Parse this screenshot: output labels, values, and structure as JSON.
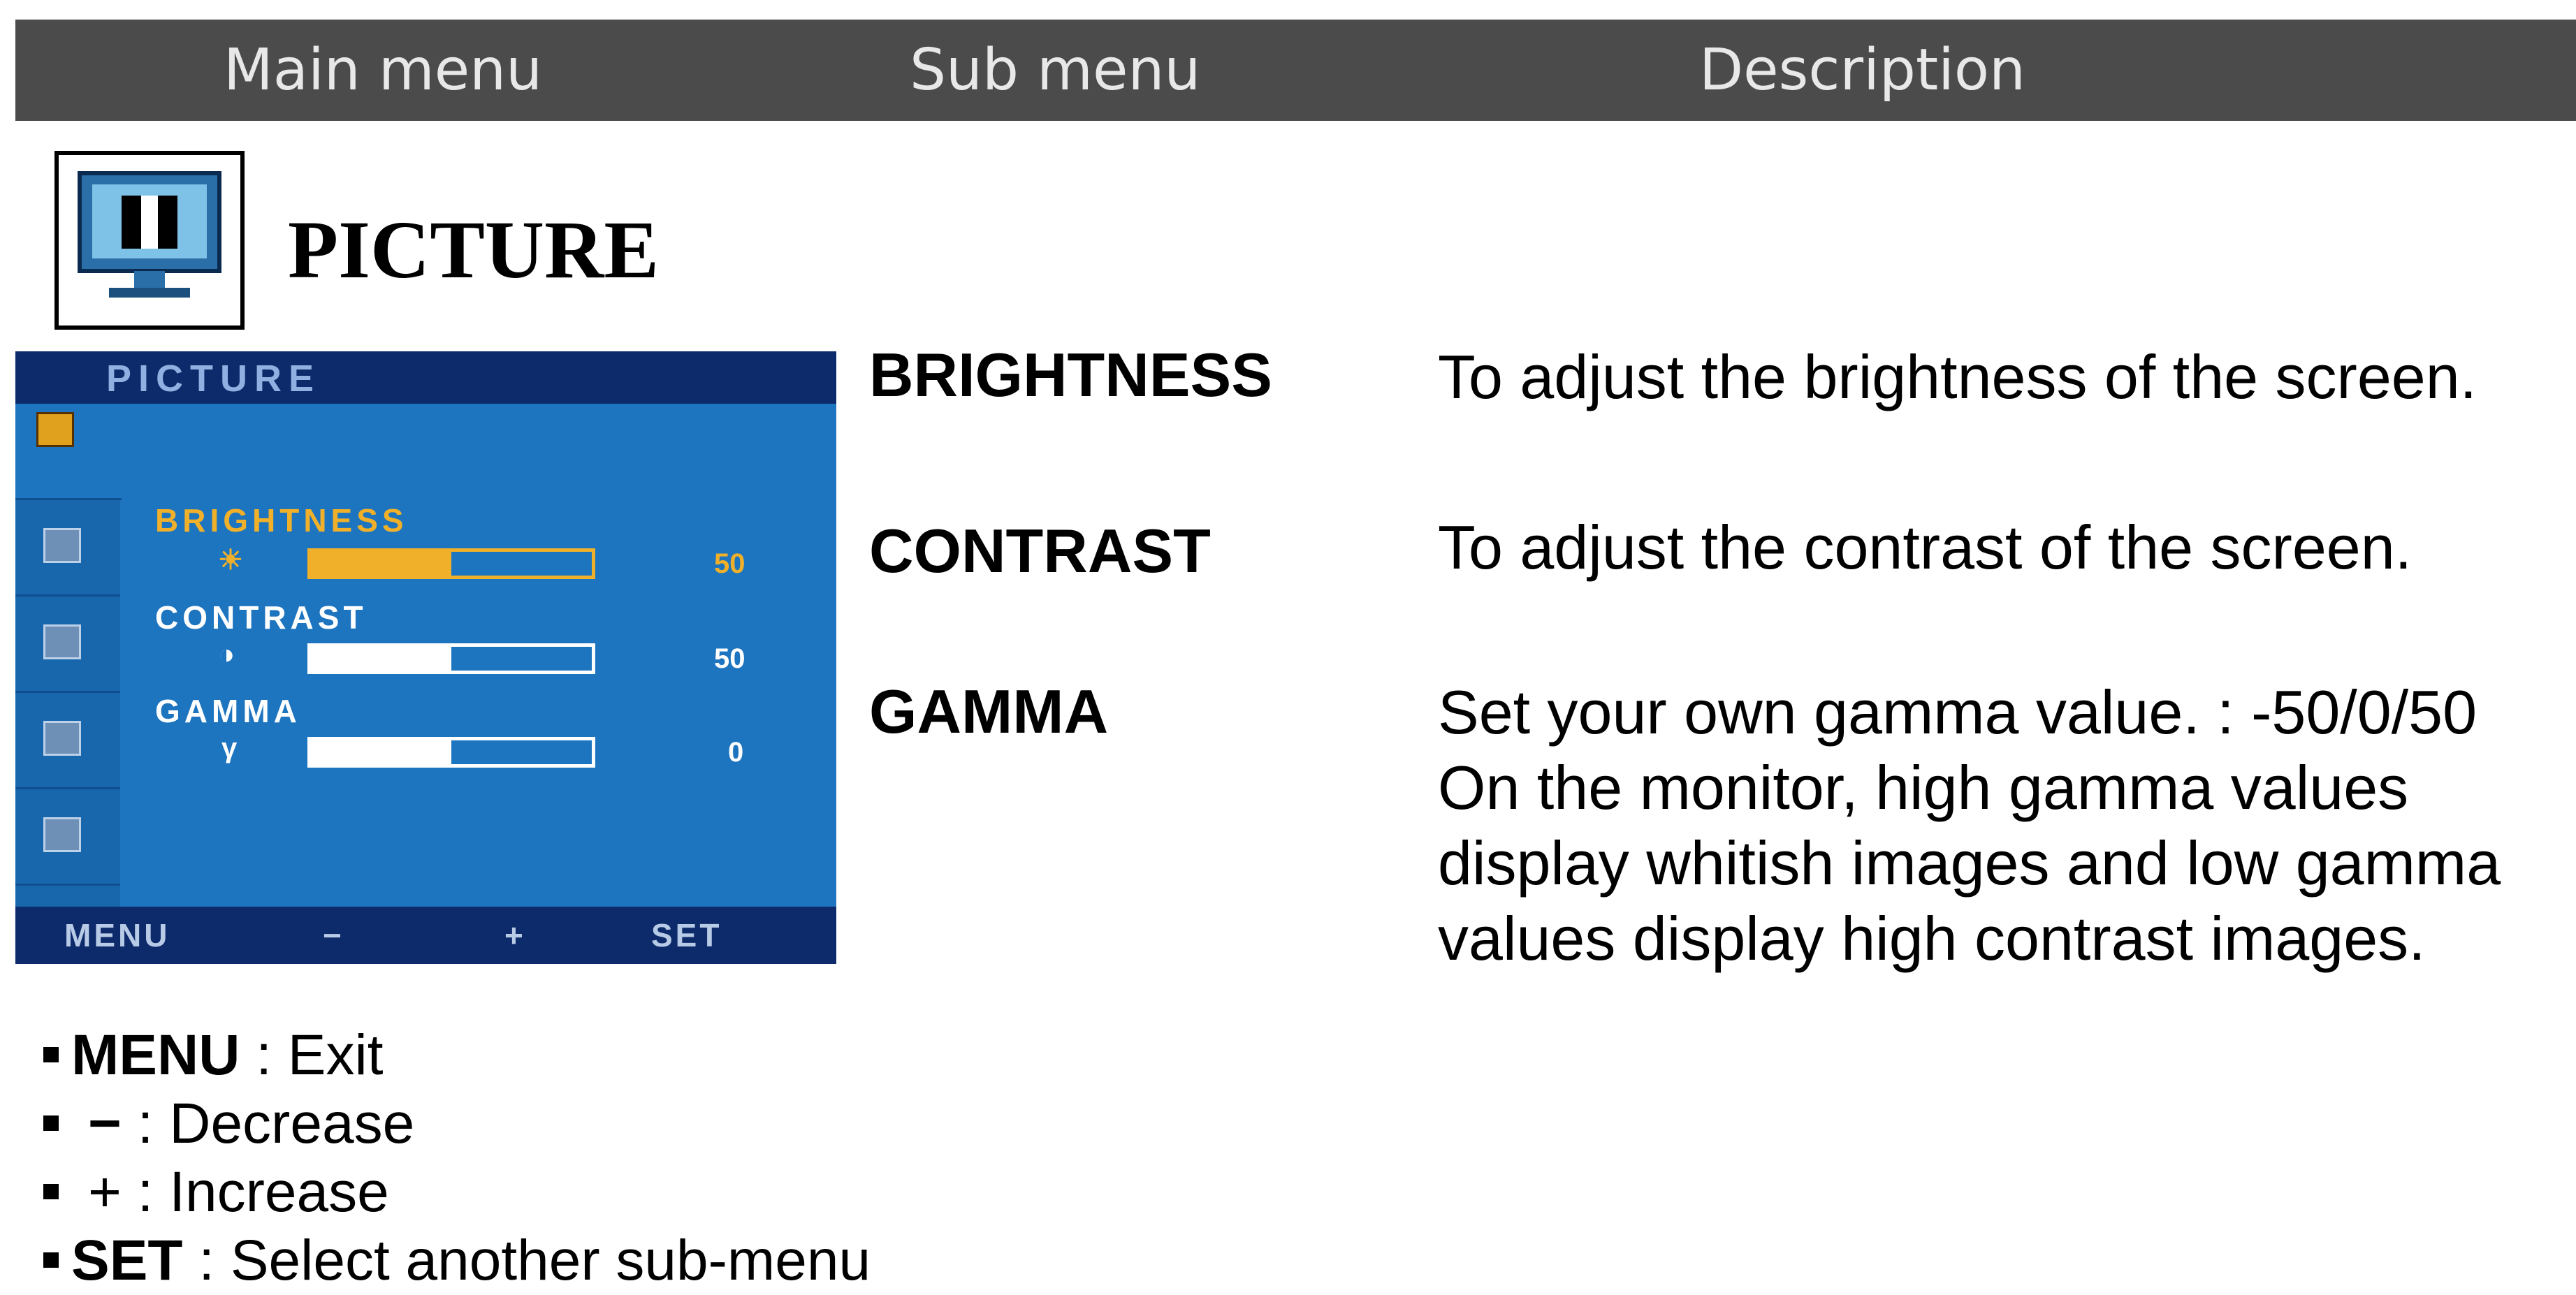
{
  "header": {
    "main_menu": "Main menu",
    "sub_menu": "Sub menu",
    "description": "Description"
  },
  "section": {
    "title": "PICTURE",
    "icon": "monitor-picture-icon"
  },
  "osd": {
    "title": "PICTURE",
    "items": [
      {
        "label": "BRIGHTNESS",
        "symbol": "☀",
        "value": "50",
        "level": 0.5,
        "active": true
      },
      {
        "label": "CONTRAST",
        "symbol": "◑",
        "value": "50",
        "level": 0.5,
        "active": false
      },
      {
        "label": "GAMMA",
        "symbol": "γ",
        "value": "0",
        "level": 0.5,
        "active": false
      }
    ],
    "footer": {
      "menu": "MENU",
      "minus": "−",
      "plus": "+",
      "set": "SET"
    },
    "colors": {
      "panel": "#1d74bf",
      "bar": "#0d2a6b",
      "active": "#e0a21e"
    }
  },
  "submenus": [
    {
      "name": "BRIGHTNESS",
      "description": [
        "To adjust the brightness of the screen."
      ]
    },
    {
      "name": "CONTRAST",
      "description": [
        "To adjust the contrast of the screen."
      ]
    },
    {
      "name": "GAMMA",
      "description": [
        "Set your own gamma value. : -50/0/50",
        "On the monitor, high gamma values",
        "display whitish images and low gamma",
        "values display high contrast images."
      ]
    }
  ],
  "legend": [
    {
      "key": "MENU",
      "text": " : Exit"
    },
    {
      "key": "−",
      "text": "  : Decrease"
    },
    {
      "key": "+",
      "text": "  : Increase"
    },
    {
      "key": "SET",
      "text": " : Select another sub-menu"
    }
  ]
}
